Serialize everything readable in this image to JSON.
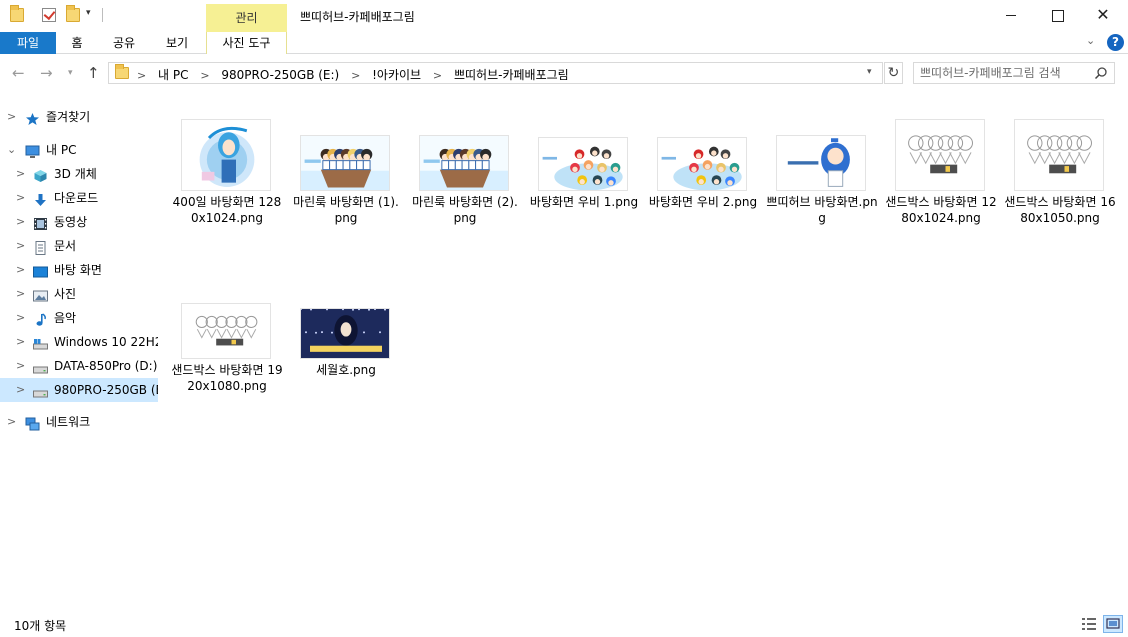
{
  "window": {
    "title": "쁘띠허브-카페배포그림",
    "context_tab_group": "관리",
    "controls": {
      "minimize": "",
      "maximize": "",
      "close": "✕"
    }
  },
  "quick_access": {
    "dropdown": "▾"
  },
  "ribbon": {
    "tabs": [
      {
        "label": "파일"
      },
      {
        "label": "홈"
      },
      {
        "label": "공유"
      },
      {
        "label": "보기"
      },
      {
        "label": "사진 도구"
      }
    ],
    "expand": "⌄",
    "help": "?"
  },
  "nav": {
    "back": "←",
    "forward": "→",
    "recent": "▾",
    "up": "↑",
    "breadcrumbs": [
      "내 PC",
      "980PRO-250GB (E:)",
      "!아카이브",
      "쁘띠허브-카페배포그림"
    ],
    "crumb_sep": ">",
    "address_dropdown": "▾",
    "refresh": "↻",
    "search_placeholder": "쁘띠허브-카페배포그림 검색"
  },
  "sidebar": {
    "items": [
      {
        "label": "즐겨찾기",
        "icon": "star-icon",
        "chevron": ">",
        "indent": 0
      },
      {
        "label": "내 PC",
        "icon": "computer-icon",
        "chevron": "⌄",
        "indent": 0
      },
      {
        "label": "3D 개체",
        "icon": "cube-3d-icon",
        "chevron": ">",
        "indent": 1
      },
      {
        "label": "다운로드",
        "icon": "download-icon",
        "chevron": ">",
        "indent": 1
      },
      {
        "label": "동영상",
        "icon": "video-icon",
        "chevron": ">",
        "indent": 1
      },
      {
        "label": "문서",
        "icon": "document-icon",
        "chevron": ">",
        "indent": 1
      },
      {
        "label": "바탕 화면",
        "icon": "desktop-icon",
        "chevron": ">",
        "indent": 1
      },
      {
        "label": "사진",
        "icon": "pictures-icon",
        "chevron": ">",
        "indent": 1
      },
      {
        "label": "음악",
        "icon": "music-icon",
        "chevron": ">",
        "indent": 1
      },
      {
        "label": "Windows 10 22H2-",
        "icon": "system-drive-icon",
        "chevron": ">",
        "indent": 1
      },
      {
        "label": "DATA-850Pro (D:)",
        "icon": "drive-icon",
        "chevron": ">",
        "indent": 1
      },
      {
        "label": "980PRO-250GB (E:",
        "icon": "drive-icon",
        "chevron": ">",
        "indent": 1,
        "selected": true
      },
      {
        "label": "네트워크",
        "icon": "network-icon",
        "chevron": ">",
        "indent": 0
      }
    ]
  },
  "files": [
    {
      "name": "400일 바탕화면 1280x1024.png",
      "thumb": "anime-portrait"
    },
    {
      "name": "마린룩 바탕화면 (1).png",
      "thumb": "boat-group"
    },
    {
      "name": "마린룩 바탕화면 (2).png",
      "thumb": "boat-group"
    },
    {
      "name": "바탕화면 우비 1.png",
      "thumb": "raincoat-group"
    },
    {
      "name": "바탕화면 우비 2.png",
      "thumb": "raincoat-group"
    },
    {
      "name": "쁘띠허브 바탕화면.png",
      "thumb": "blue-hair-girl"
    },
    {
      "name": "샌드박스 바탕화면 1280x1024.png",
      "thumb": "sandbox-sketch"
    },
    {
      "name": "샌드박스 바탕화면 1680x1050.png",
      "thumb": "sandbox-sketch"
    },
    {
      "name": "샌드박스 바탕화면 1920x1080.png",
      "thumb": "sandbox-sketch"
    },
    {
      "name": "세월호.png",
      "thumb": "dark-night"
    }
  ],
  "status": {
    "item_count": "10개 항목"
  },
  "colors": {
    "file_tab": "#1979ca",
    "context_tab": "#f6f094",
    "selection": "#cce8ff",
    "help": "#1565c0"
  }
}
